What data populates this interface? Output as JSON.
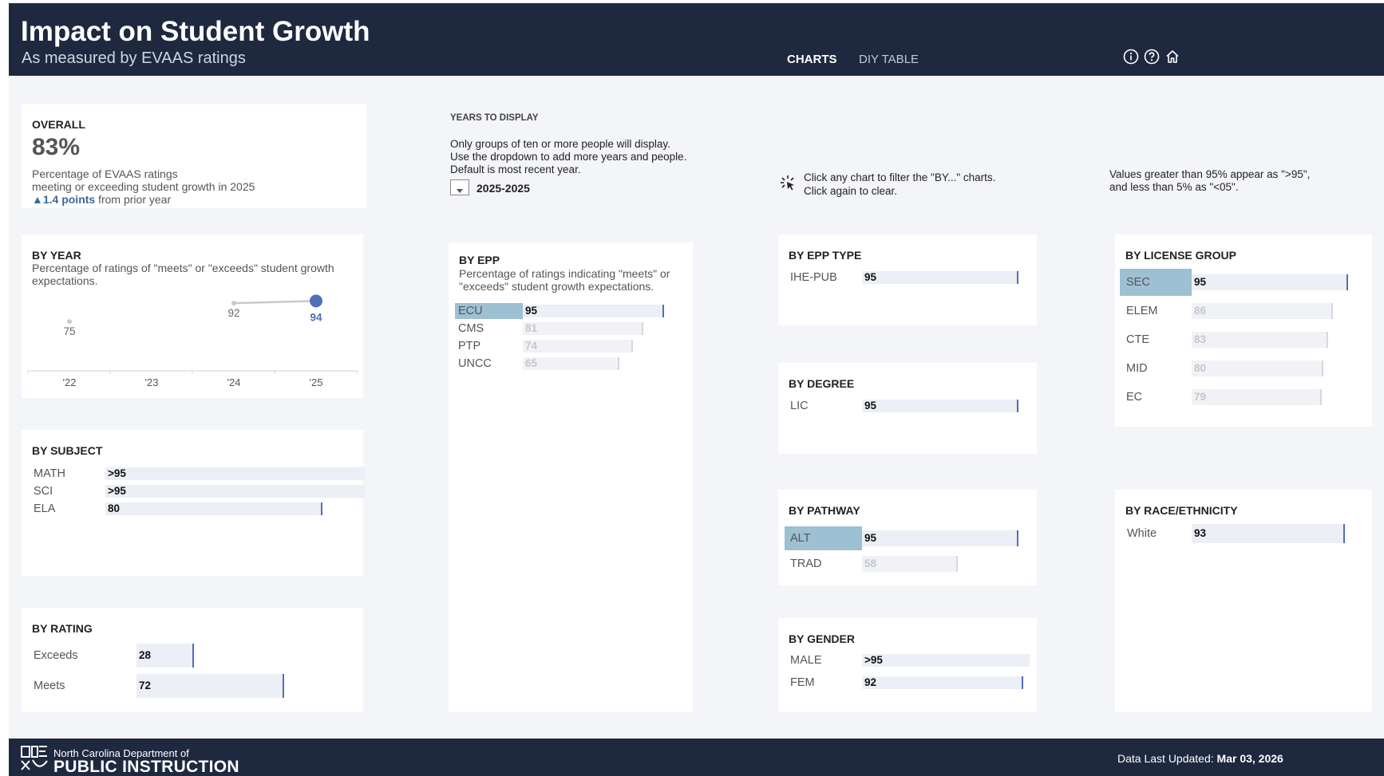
{
  "header": {
    "title": "Impact on Student Growth",
    "subtitle": "As measured by EVAAS ratings",
    "tabs": [
      {
        "label": "CHARTS",
        "active": true
      },
      {
        "label": "DIY TABLE",
        "active": false
      }
    ],
    "icons": [
      "info-icon",
      "help-icon",
      "home-icon"
    ]
  },
  "overall": {
    "title": "OVERALL",
    "value": "83%",
    "desc_line1": "Percentage of EVAAS ratings",
    "desc_line2": "meeting or exceeding student growth in 2025",
    "change": "▲1.4 points",
    "change_suffix": "from prior year"
  },
  "years": {
    "label": "YEARS TO DISPLAY",
    "note_line1": "Only groups of ten or more people will display.",
    "note_line2": "Use the dropdown to add more years and people.",
    "note_line3": "Default is most recent year.",
    "selected": "2025-2025"
  },
  "hint": {
    "line1": "Click any chart to filter the \"BY...\" charts.",
    "line2": "Click again to clear."
  },
  "values_note": {
    "line1": "Values greater than 95% appear as \">95\",",
    "line2": "and less than 5% as \"<05\"."
  },
  "by_year": {
    "title": "BY YEAR",
    "desc": "Percentage of ratings of \"meets\" or \"exceeds\" student growth expectations.",
    "chart_data": {
      "type": "line",
      "categories": [
        "'22",
        "'23",
        "'24",
        "'25"
      ],
      "values": [
        75,
        null,
        92,
        94
      ],
      "value_labels": [
        "75",
        "",
        "92",
        "94"
      ]
    }
  },
  "by_subject": {
    "title": "BY SUBJECT",
    "rows": [
      {
        "label": "MATH",
        "display": ">95",
        "value": 96
      },
      {
        "label": "SCI",
        "display": ">95",
        "value": 96
      },
      {
        "label": "ELA",
        "display": "80",
        "value": 80
      }
    ]
  },
  "by_rating": {
    "title": "BY RATING",
    "rows": [
      {
        "label": "Exceeds",
        "display": "28",
        "value": 28
      },
      {
        "label": "Meets",
        "display": "72",
        "value": 72
      }
    ]
  },
  "by_epp": {
    "title": "BY EPP",
    "desc": "Percentage of ratings indicating \"meets\" or \"exceeds\" student growth expectations.",
    "rows": [
      {
        "label": "ECU",
        "display": "95",
        "value": 95,
        "selected": true
      },
      {
        "label": "CMS",
        "display": "81",
        "value": 81,
        "selected": false
      },
      {
        "label": "PTP",
        "display": "74",
        "value": 74,
        "selected": false
      },
      {
        "label": "UNCC",
        "display": "65",
        "value": 65,
        "selected": false
      }
    ]
  },
  "by_epp_type": {
    "title": "BY EPP TYPE",
    "rows": [
      {
        "label": "IHE-PUB",
        "display": "95",
        "value": 95
      }
    ]
  },
  "by_degree": {
    "title": "BY DEGREE",
    "rows": [
      {
        "label": "LIC",
        "display": "95",
        "value": 95
      }
    ]
  },
  "by_pathway": {
    "title": "BY PATHWAY",
    "rows": [
      {
        "label": "ALT",
        "display": "95",
        "value": 95,
        "selected": true
      },
      {
        "label": "TRAD",
        "display": "58",
        "value": 58,
        "selected": false
      }
    ]
  },
  "by_gender": {
    "title": "BY GENDER",
    "rows": [
      {
        "label": "MALE",
        "display": ">95",
        "value": 96
      },
      {
        "label": "FEM",
        "display": "92",
        "value": 92
      }
    ]
  },
  "by_license_group": {
    "title": "BY LICENSE GROUP",
    "rows": [
      {
        "label": "SEC",
        "display": "95",
        "value": 95,
        "selected": true
      },
      {
        "label": "ELEM",
        "display": "86",
        "value": 86,
        "selected": false
      },
      {
        "label": "CTE",
        "display": "83",
        "value": 83,
        "selected": false
      },
      {
        "label": "MID",
        "display": "80",
        "value": 80,
        "selected": false
      },
      {
        "label": "EC",
        "display": "79",
        "value": 79,
        "selected": false
      }
    ]
  },
  "by_race": {
    "title": "BY RACE/ETHNICITY",
    "rows": [
      {
        "label": "White",
        "display": "93",
        "value": 93
      }
    ]
  },
  "footer": {
    "org_line1": "North Carolina Department of",
    "org_line2": "PUBLIC INSTRUCTION",
    "updated_label": "Data Last Updated:",
    "updated_value": "Mar 03, 2026"
  },
  "colors": {
    "header_bg": "#1e2940",
    "accent": "#4f6fb8",
    "selected_row": "#9dc0d2",
    "bar_track": "#eceff6",
    "bar_fill": "#dde2ee",
    "change_text": "#3a6a9a"
  }
}
